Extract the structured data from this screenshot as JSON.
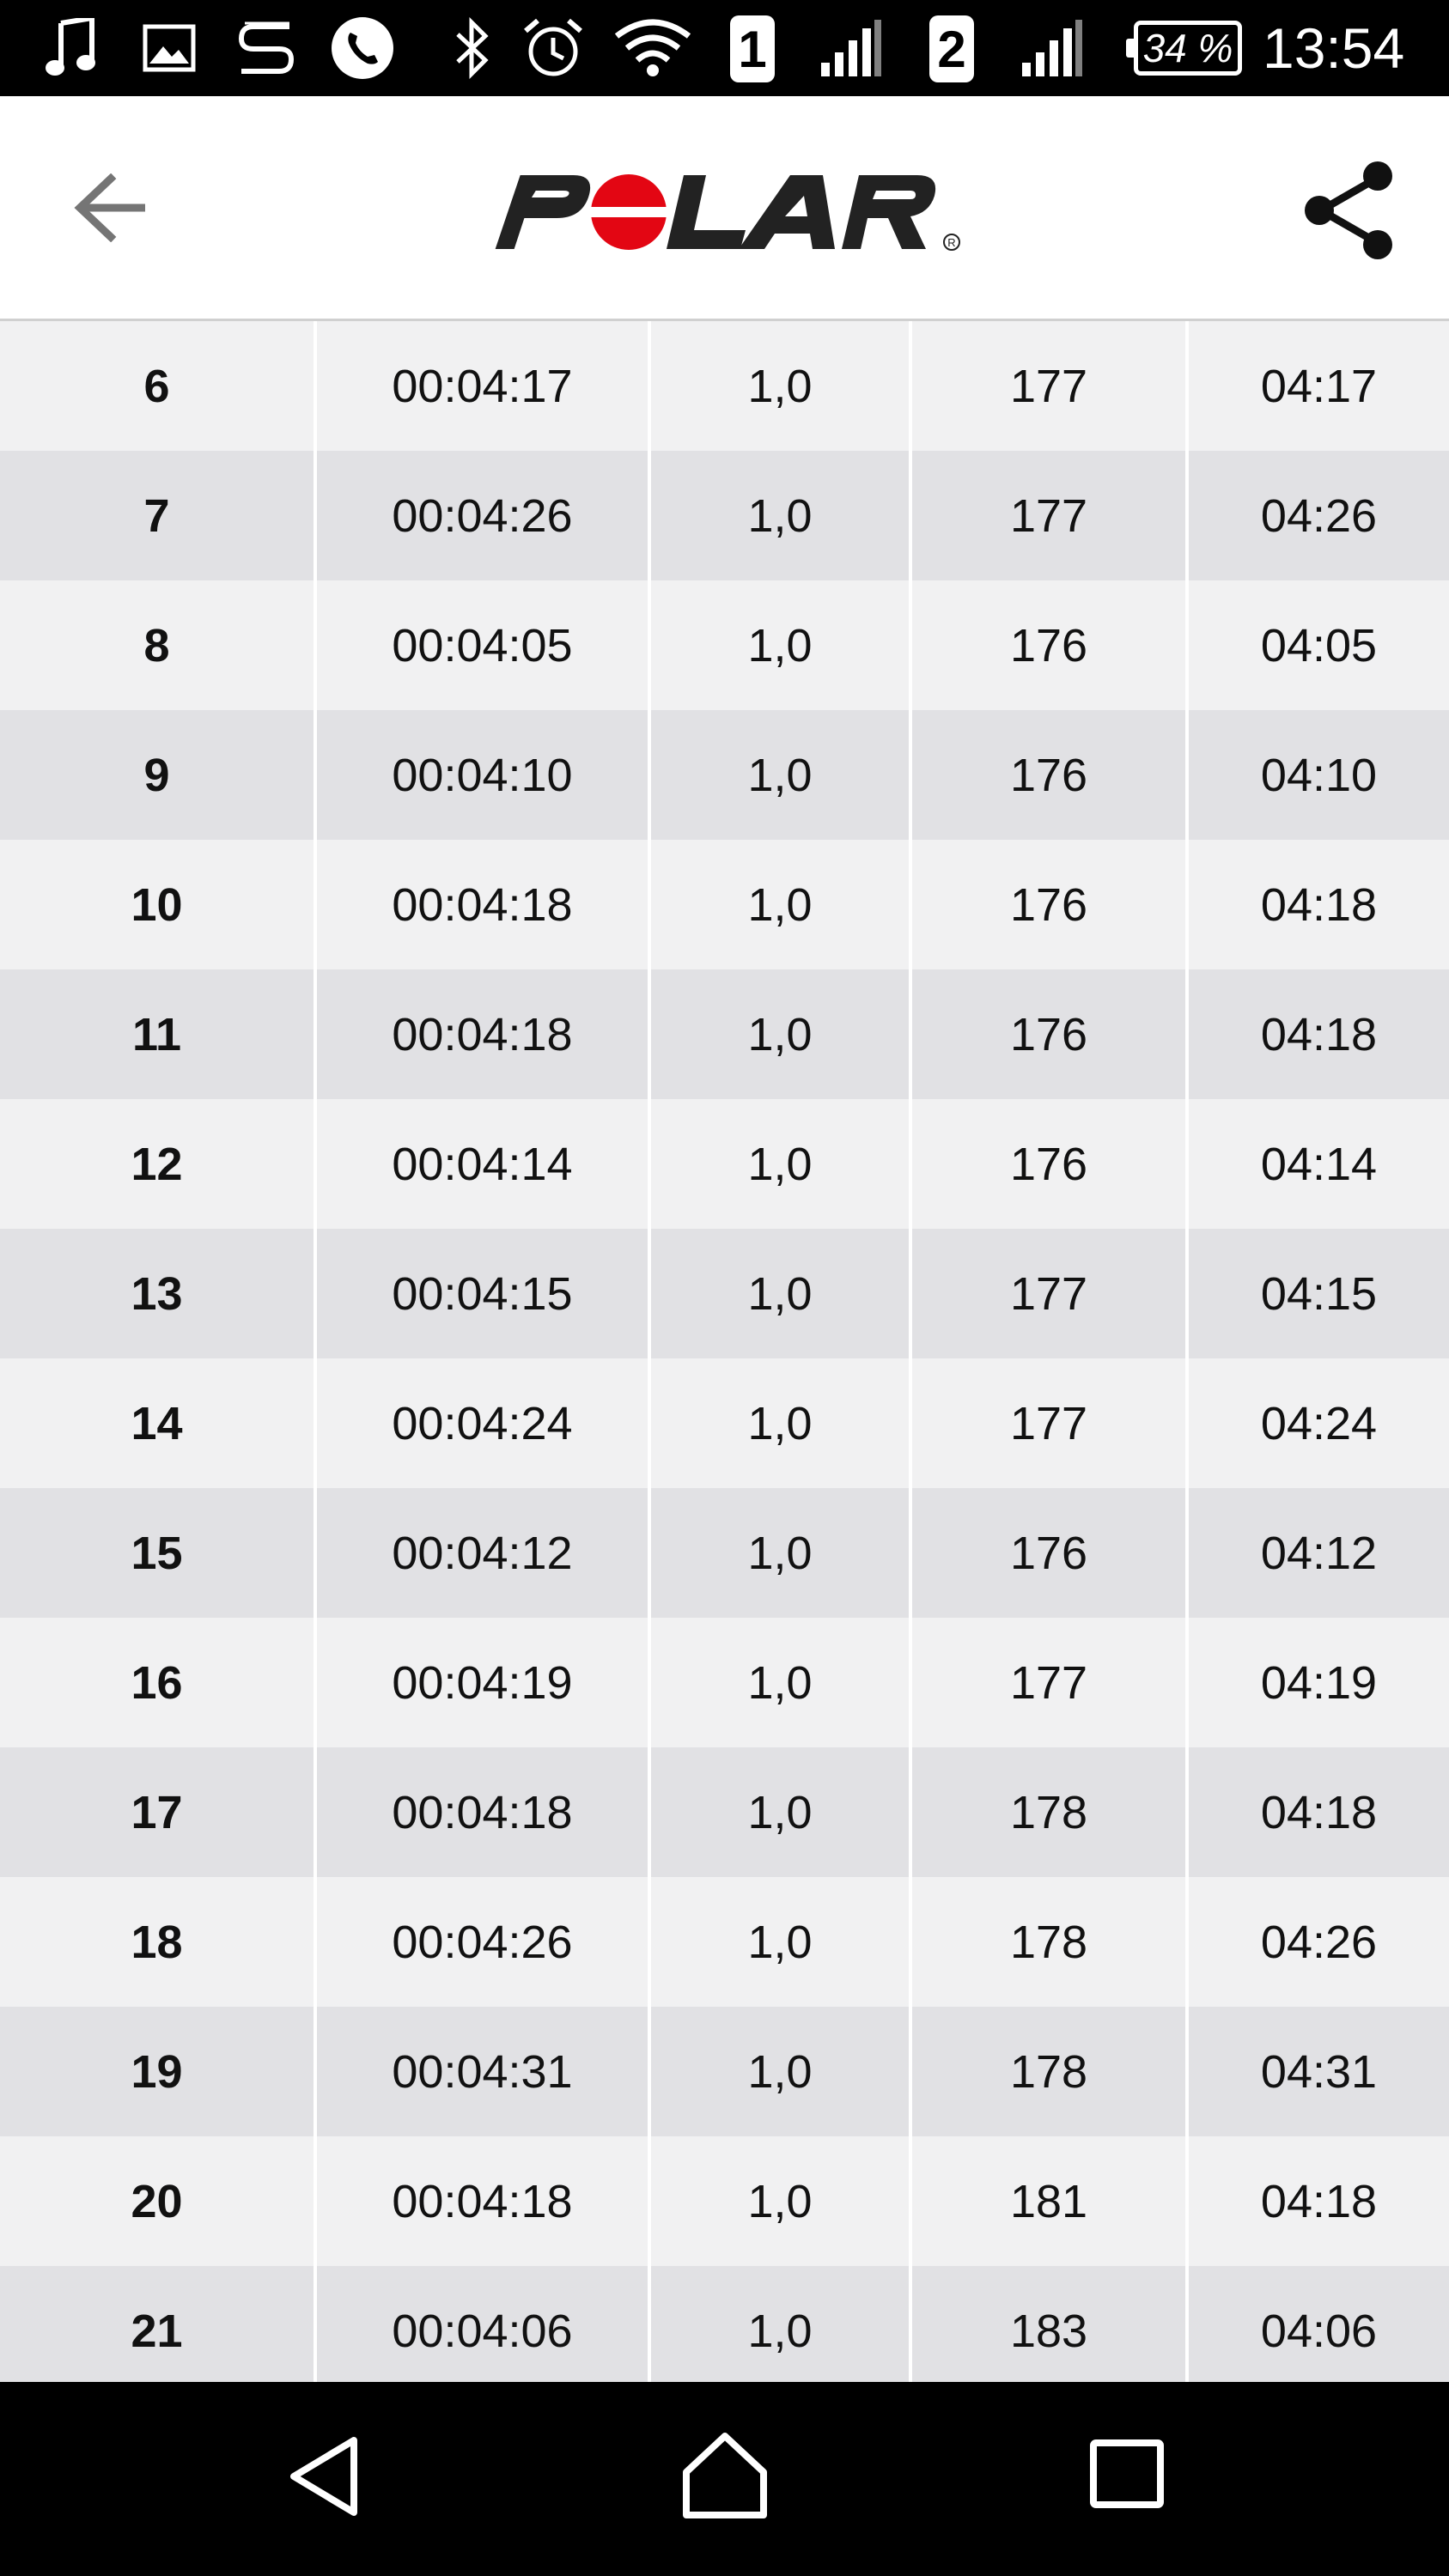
{
  "status_bar": {
    "time": "13:54",
    "battery": "34 %",
    "sim1": "1",
    "sim2": "2",
    "icons": [
      "music-icon",
      "image-icon",
      "s-app-icon",
      "phone-icon",
      "bluetooth-icon",
      "alarm-icon",
      "wifi-icon",
      "signal-icon",
      "signal-icon",
      "battery-icon"
    ]
  },
  "app_bar": {
    "logo_text": "POLAR",
    "icons": [
      "back-arrow-icon",
      "share-icon"
    ]
  },
  "table": {
    "rows": [
      {
        "lap": "6",
        "time": "00:04:17",
        "distance": "1,0",
        "hr": "177",
        "pace": "04:17"
      },
      {
        "lap": "7",
        "time": "00:04:26",
        "distance": "1,0",
        "hr": "177",
        "pace": "04:26"
      },
      {
        "lap": "8",
        "time": "00:04:05",
        "distance": "1,0",
        "hr": "176",
        "pace": "04:05"
      },
      {
        "lap": "9",
        "time": "00:04:10",
        "distance": "1,0",
        "hr": "176",
        "pace": "04:10"
      },
      {
        "lap": "10",
        "time": "00:04:18",
        "distance": "1,0",
        "hr": "176",
        "pace": "04:18"
      },
      {
        "lap": "11",
        "time": "00:04:18",
        "distance": "1,0",
        "hr": "176",
        "pace": "04:18"
      },
      {
        "lap": "12",
        "time": "00:04:14",
        "distance": "1,0",
        "hr": "176",
        "pace": "04:14"
      },
      {
        "lap": "13",
        "time": "00:04:15",
        "distance": "1,0",
        "hr": "177",
        "pace": "04:15"
      },
      {
        "lap": "14",
        "time": "00:04:24",
        "distance": "1,0",
        "hr": "177",
        "pace": "04:24"
      },
      {
        "lap": "15",
        "time": "00:04:12",
        "distance": "1,0",
        "hr": "176",
        "pace": "04:12"
      },
      {
        "lap": "16",
        "time": "00:04:19",
        "distance": "1,0",
        "hr": "177",
        "pace": "04:19"
      },
      {
        "lap": "17",
        "time": "00:04:18",
        "distance": "1,0",
        "hr": "178",
        "pace": "04:18"
      },
      {
        "lap": "18",
        "time": "00:04:26",
        "distance": "1,0",
        "hr": "178",
        "pace": "04:26"
      },
      {
        "lap": "19",
        "time": "00:04:31",
        "distance": "1,0",
        "hr": "178",
        "pace": "04:31"
      },
      {
        "lap": "20",
        "time": "00:04:18",
        "distance": "1,0",
        "hr": "181",
        "pace": "04:18"
      },
      {
        "lap": "21",
        "time": "00:04:06",
        "distance": "1,0",
        "hr": "183",
        "pace": "04:06"
      }
    ]
  },
  "nav_bar": {
    "icons": [
      "back-triangle-icon",
      "home-icon",
      "recents-icon"
    ]
  },
  "colors": {
    "brand_red": "#e30613",
    "logo_dark": "#222222",
    "row_light": "#f1f1f2",
    "row_dark": "#e1e1e4"
  }
}
